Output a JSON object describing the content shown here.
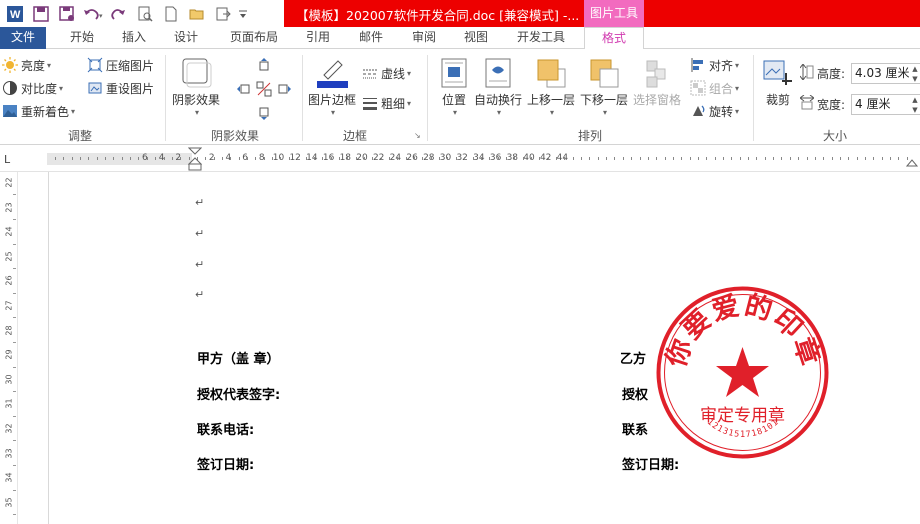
{
  "window": {
    "title": "【模板】202007软件开发合同.doc [兼容模式] -...",
    "context_tab": "图片工具"
  },
  "tabs": {
    "file": "文件",
    "home": "开始",
    "insert": "插入",
    "design": "设计",
    "layout": "页面布局",
    "references": "引用",
    "mailings": "邮件",
    "review": "审阅",
    "view": "视图",
    "developer": "开发工具",
    "format": "格式"
  },
  "ribbon": {
    "adjust": {
      "brightness": "亮度",
      "contrast": "对比度",
      "recolor": "重新着色",
      "compress": "压缩图片",
      "reset": "重设图片",
      "label": "调整"
    },
    "shadow": {
      "effects": "阴影效果",
      "label": "阴影效果"
    },
    "border": {
      "picture_border": "图片边框",
      "dashes": "虚线",
      "weight": "粗细",
      "label": "边框"
    },
    "arrange": {
      "position": "位置",
      "wrap": "自动换行",
      "bring_forward": "上移一层",
      "send_backward": "下移一层",
      "selection_pane": "选择窗格",
      "align": "对齐",
      "group": "组合",
      "rotate": "旋转",
      "label": "排列"
    },
    "size": {
      "crop": "裁剪",
      "height_label": "高度:",
      "height_value": "4.03 厘米",
      "width_label": "宽度:",
      "width_value": "4 厘米",
      "label": "大小"
    }
  },
  "ruler": {
    "h_left": [
      "6",
      "4",
      "2"
    ],
    "h_right": [
      "2",
      "4",
      "6",
      "8",
      "10",
      "12",
      "14",
      "16",
      "18",
      "20",
      "22",
      "24",
      "26",
      "28",
      "30",
      "32",
      "34",
      "36",
      "38",
      "40",
      "42",
      "44"
    ],
    "v": [
      "22",
      "23",
      "24",
      "25",
      "26",
      "27",
      "28",
      "29",
      "30",
      "31",
      "32",
      "33",
      "34",
      "35"
    ]
  },
  "document": {
    "para_mark": "↵",
    "party_a": "甲方（盖 章）",
    "auth_rep": "授权代表签字:",
    "phone": "联系电话:",
    "sign_date": "签订日期:",
    "party_b": "乙方",
    "auth_rep_b": "授权",
    "phone_b": "联系",
    "sign_date_b": "签订日期:"
  },
  "stamp": {
    "top_text": "你要爱的印章",
    "bottom_text": "审定专用章",
    "serial": "1213151718101",
    "color": "#e0202a"
  }
}
